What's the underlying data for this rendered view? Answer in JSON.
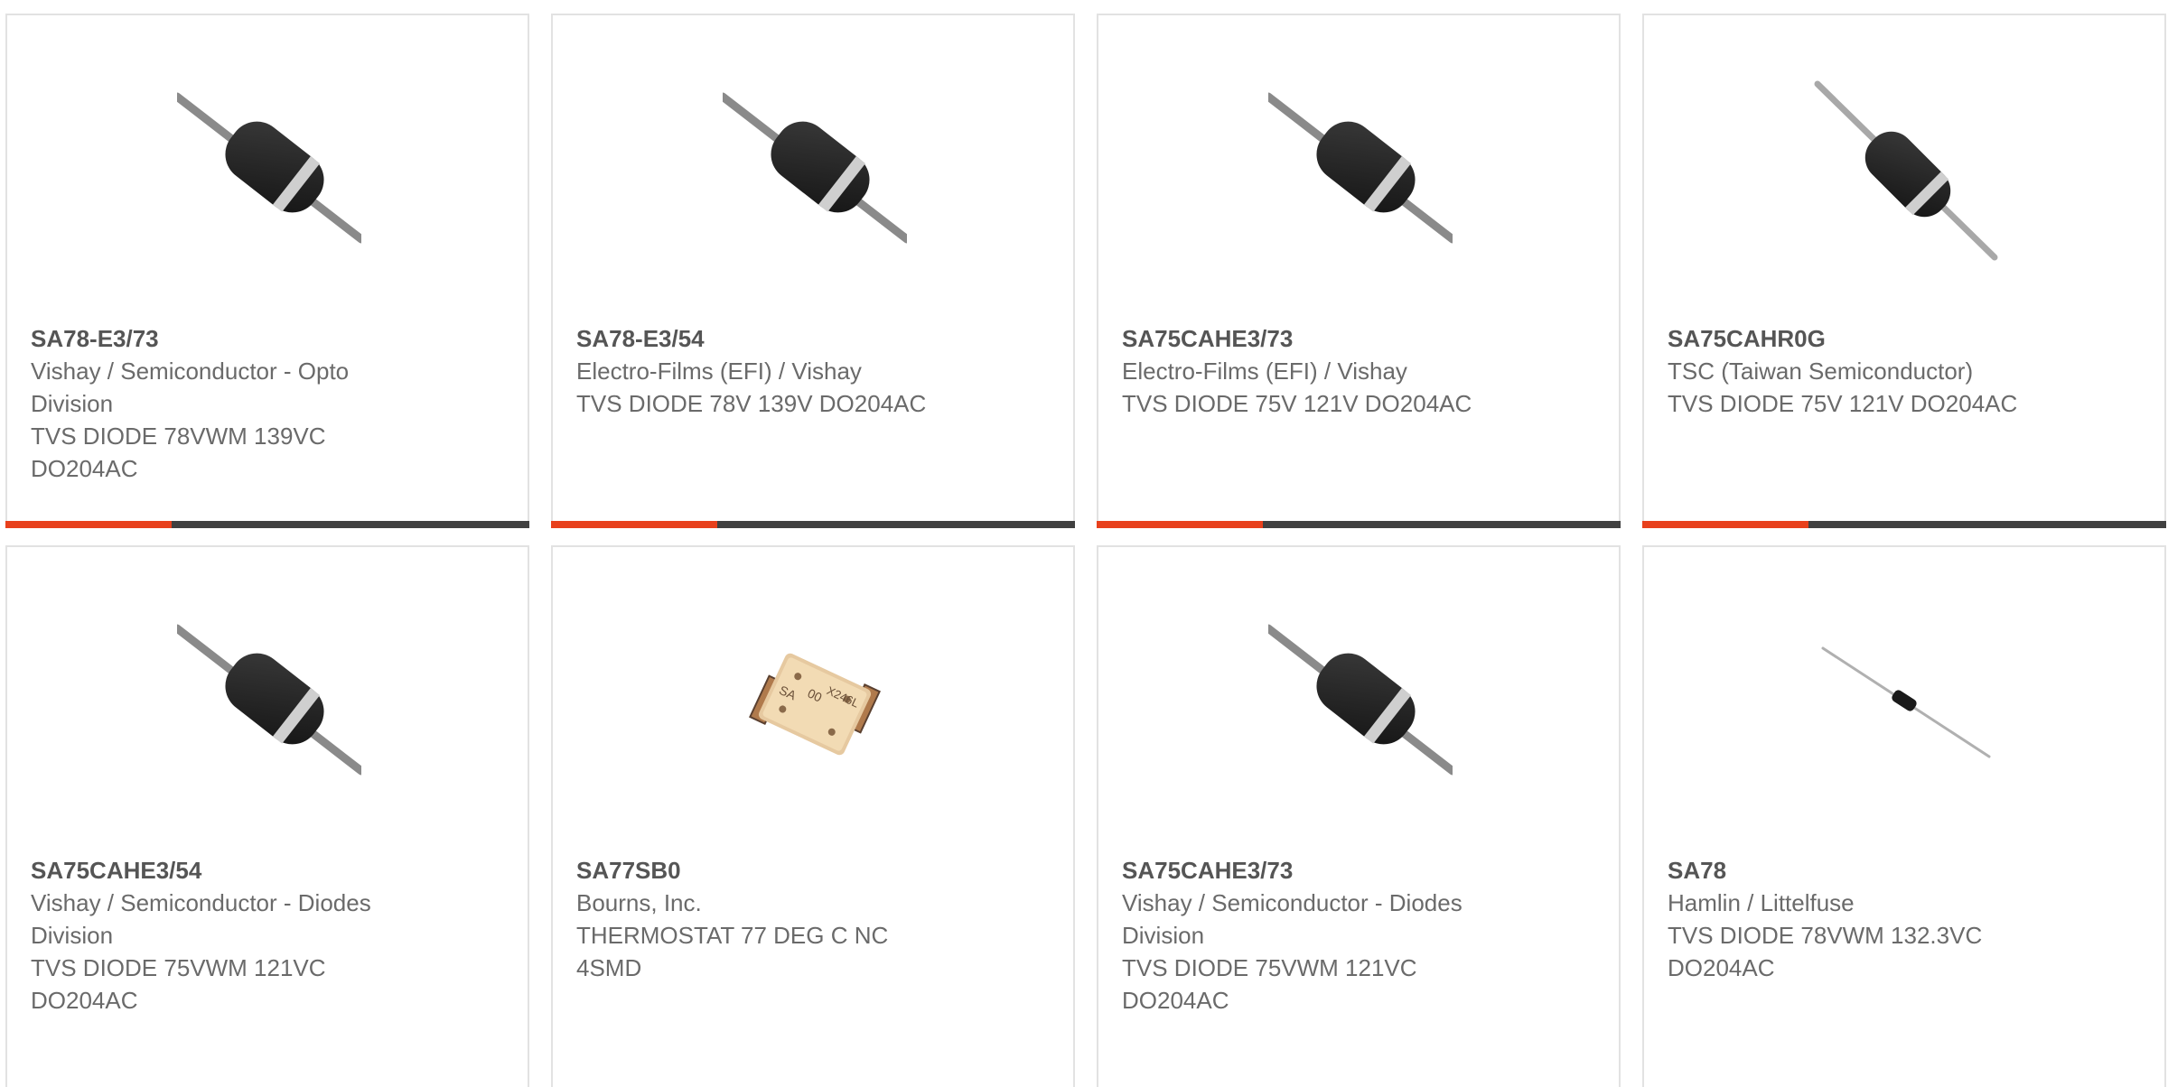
{
  "colors": {
    "accent": "#e8401c",
    "bar": "#404040",
    "border": "#e2e2e2",
    "text": "#6a6a6a"
  },
  "products": [
    {
      "part_number": "SA78-E3/73",
      "manufacturer": "Vishay / Semiconductor - Opto Division",
      "description": "TVS DIODE 78VWM 139VC DO204AC",
      "image": "axial-diode-large"
    },
    {
      "part_number": "SA78-E3/54",
      "manufacturer": "Electro-Films (EFI) / Vishay",
      "description": "TVS DIODE 78V 139V DO204AC",
      "image": "axial-diode-large"
    },
    {
      "part_number": "SA75CAHE3/73",
      "manufacturer": "Electro-Films (EFI) / Vishay",
      "description": "TVS DIODE 75V 121V DO204AC",
      "image": "axial-diode-large"
    },
    {
      "part_number": "SA75CAHR0G",
      "manufacturer": "TSC (Taiwan Semiconductor)",
      "description": "TVS DIODE 75V 121V DO204AC",
      "image": "axial-diode-steep"
    },
    {
      "part_number": "SA75CAHE3/54",
      "manufacturer": "Vishay / Semiconductor - Diodes Division",
      "description": "TVS DIODE 75VWM 121VC DO204AC",
      "image": "axial-diode-large"
    },
    {
      "part_number": "SA77SB0",
      "manufacturer": "Bourns, Inc.",
      "description": "THERMOSTAT 77 DEG C NC 4SMD",
      "image": "smd-thermostat",
      "chip_marking": [
        "SA",
        "00",
        "X246L"
      ]
    },
    {
      "part_number": "SA75CAHE3/73",
      "manufacturer": "Vishay / Semiconductor - Diodes Division",
      "description": "TVS DIODE 75VWM 121VC DO204AC",
      "image": "axial-diode-large"
    },
    {
      "part_number": "SA78",
      "manufacturer": "Hamlin / Littelfuse",
      "description": "TVS DIODE 78VWM 132.3VC DO204AC",
      "image": "axial-diode-small"
    }
  ]
}
